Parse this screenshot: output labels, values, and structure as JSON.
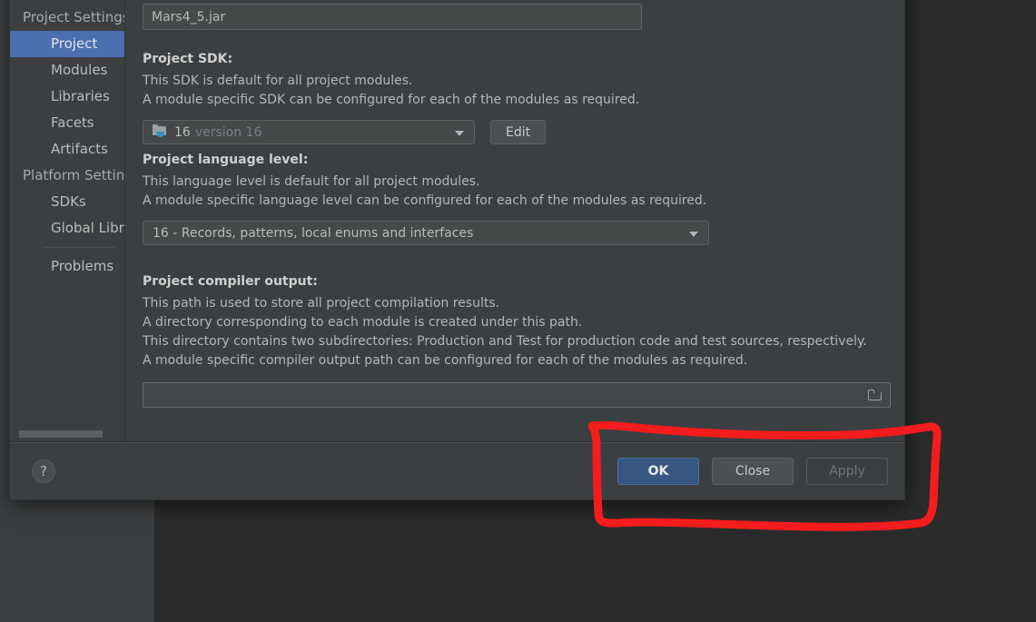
{
  "dialog": {
    "name_field": {
      "value": "Mars4_5.jar",
      "placeholder": ""
    },
    "sidebar": {
      "groups": [
        {
          "label": "Project Settings",
          "type": "group"
        },
        {
          "label": "Project",
          "type": "child",
          "selected": true
        },
        {
          "label": "Modules",
          "type": "child",
          "selected": false
        },
        {
          "label": "Libraries",
          "type": "child",
          "selected": false
        },
        {
          "label": "Facets",
          "type": "child",
          "selected": false
        },
        {
          "label": "Artifacts",
          "type": "child",
          "selected": false
        },
        {
          "label": "Platform Settings",
          "type": "group"
        },
        {
          "label": "SDKs",
          "type": "child",
          "selected": false
        },
        {
          "label": "Global Libraries",
          "type": "child",
          "selected": false
        },
        {
          "label": "Problems",
          "type": "child",
          "selected": false
        }
      ]
    },
    "sections": {
      "sdk": {
        "title": "Project SDK:",
        "line1": "This SDK is default for all project modules.",
        "line2": "A module specific SDK can be configured for each of the modules as required.",
        "selected_name": "16",
        "selected_version": "version 16",
        "edit_label": "Edit",
        "icon": "java-sdk-icon"
      },
      "language_level": {
        "title": "Project language level:",
        "line1": "This language level is default for all project modules.",
        "line2": "A module specific language level can be configured for each of the modules as required.",
        "selected": "16 - Records, patterns, local enums and interfaces"
      },
      "compiler_output": {
        "title": "Project compiler output:",
        "line1": "This path is used to store all project compilation results.",
        "line2": "A directory corresponding to each module is created under this path.",
        "line3": "This directory contains two subdirectories: Production and Test for production code and test sources, respectively.",
        "line4": "A module specific compiler output path can be configured for each of the modules as required.",
        "value": "",
        "placeholder": "",
        "browse_icon": "folder-browse-icon"
      }
    },
    "footer": {
      "help_label": "?",
      "ok_label": "OK",
      "close_label": "Close",
      "apply_label": "Apply"
    }
  },
  "colors": {
    "accent": "#4b6eaf",
    "primary_button": "#365880",
    "annotation": "#f41c1c",
    "panel": "#3c3f41",
    "backdrop": "#2b2b2b"
  },
  "annotation": {
    "shape": "hand-drawn-rectangle",
    "color": "#f41c1c",
    "target": "footer-action-buttons"
  }
}
